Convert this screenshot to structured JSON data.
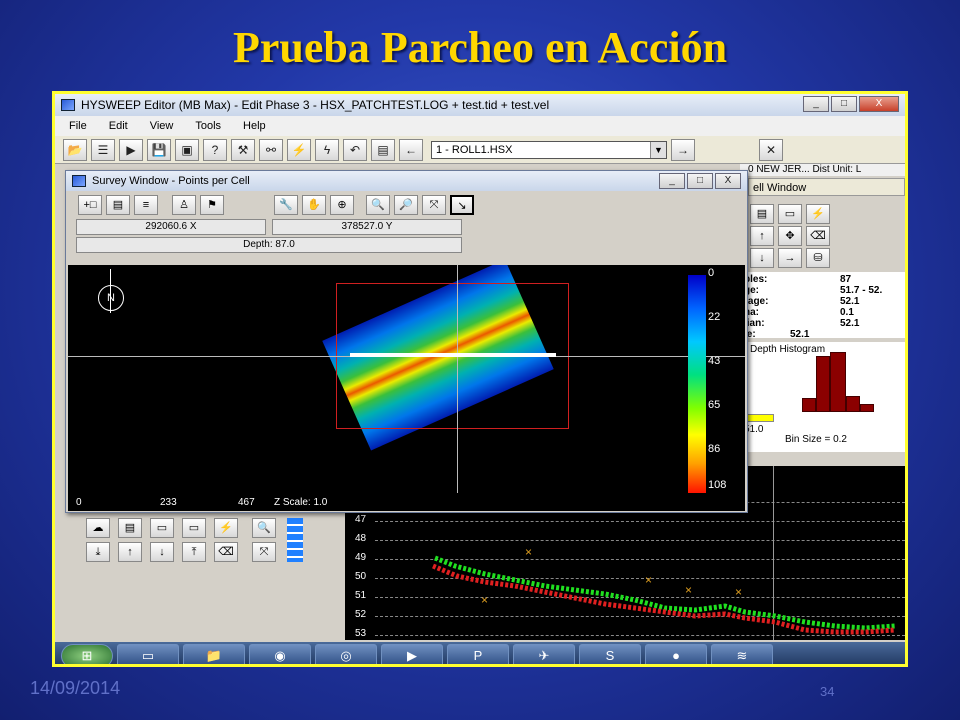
{
  "slide": {
    "title": "Prueba Parcheo en Acción",
    "date": "14/09/2014",
    "page_number": "34"
  },
  "editor": {
    "window_title": "HYSWEEP Editor (MB Max) - Edit Phase 3 - HSX_PATCHTEST.LOG + test.tid + test.vel",
    "menu": [
      "File",
      "Edit",
      "View",
      "Tools",
      "Help"
    ],
    "file_select_value": "1 - ROLL1.HSX",
    "window_buttons": [
      "_",
      "□",
      "X"
    ]
  },
  "cell_window": {
    "top_text": "0 NEW JER...   Dist Unit: L",
    "title": "ell Window",
    "stats": [
      {
        "label": "ples:",
        "value": "87"
      },
      {
        "label": "ge:",
        "value": "51.7 - 52."
      },
      {
        "label": "rage:",
        "value": "52.1"
      },
      {
        "label": "na:",
        "value": "0.1"
      },
      {
        "label": "lian:",
        "value": "52.1"
      },
      {
        "label": "le:",
        "value": "52.1"
      }
    ],
    "histogram_title": "Depth Histogram",
    "hist_left_value": "51.0",
    "bin_size": "Bin Size = 0.2"
  },
  "survey_window": {
    "title": "Survey Window - Points per Cell",
    "x_coord": "292060.6 X",
    "y_coord": "378527.0 Y",
    "depth": "Depth: 87.0",
    "north_label": "N",
    "colorbar_labels": [
      "0",
      "22",
      "43",
      "65",
      "86",
      "108"
    ],
    "x_ticks": [
      "0",
      "233",
      "467"
    ],
    "z_scale": "Z Scale: 1.0"
  },
  "profile": {
    "depth_labels": [
      "47",
      "48",
      "49",
      "50",
      "51",
      "52",
      "53"
    ]
  },
  "colors": {
    "title_gold": "#ffd700",
    "frame_yellow": "#ffff30",
    "slide_blue": "#2238a8"
  }
}
